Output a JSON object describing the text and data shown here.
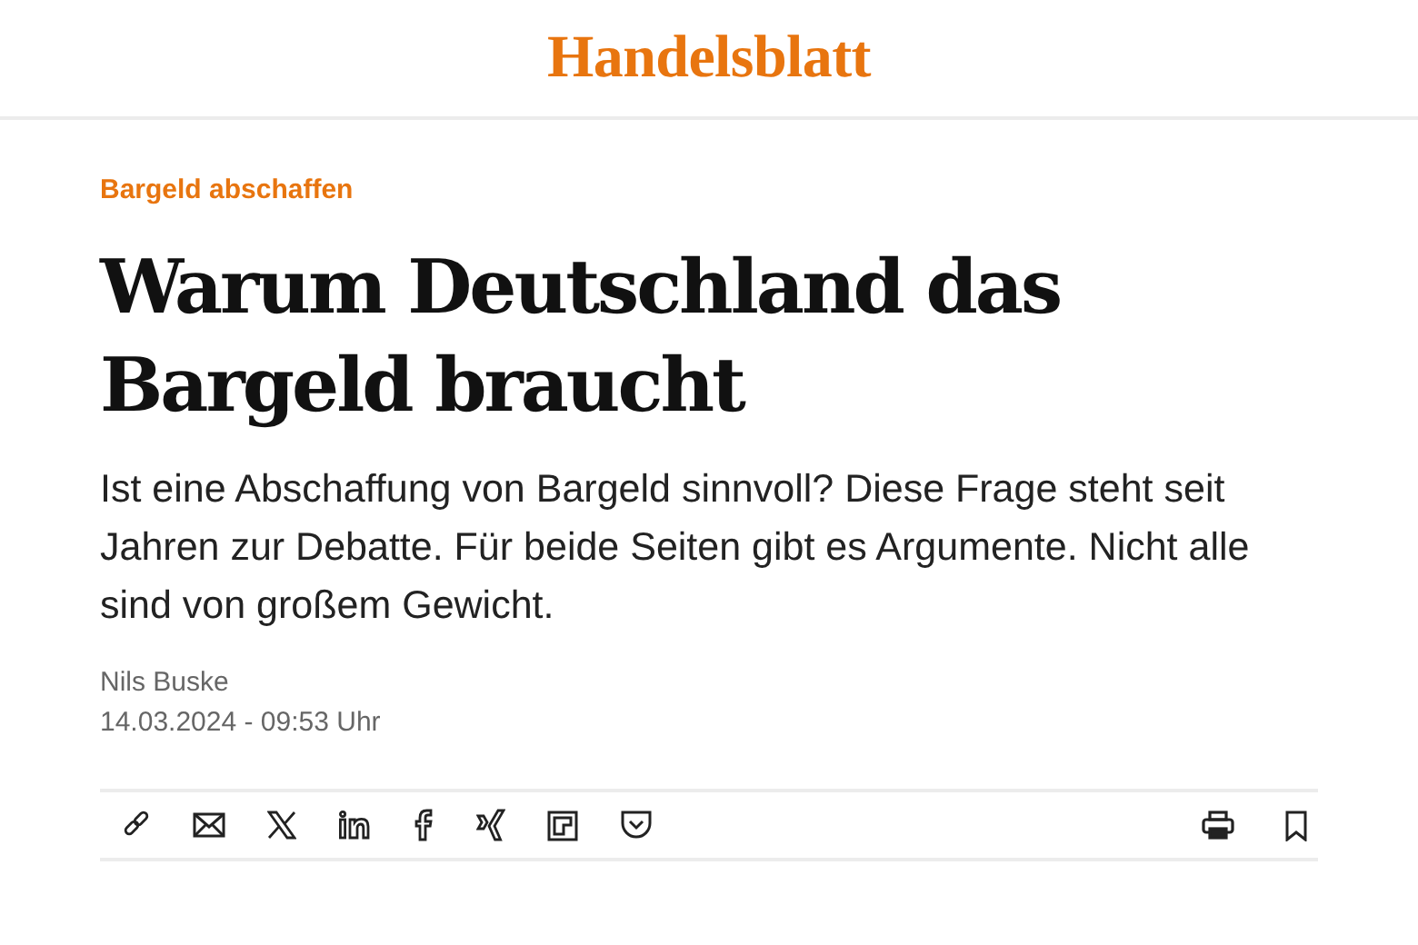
{
  "header": {
    "logo": "Handelsblatt"
  },
  "article": {
    "kicker": "Bargeld abschaffen",
    "headline": "Warum Deutschland das Bargeld braucht",
    "teaser": "Ist eine Abschaffung von Bargeld sinnvoll? Diese Frage steht seit Jahren zur Debatte. Für beide Seiten gibt es Argumente. Nicht alle sind von großem Gewicht.",
    "author": "Nils Buske",
    "date": "14.03.2024 - 09:53 Uhr"
  }
}
